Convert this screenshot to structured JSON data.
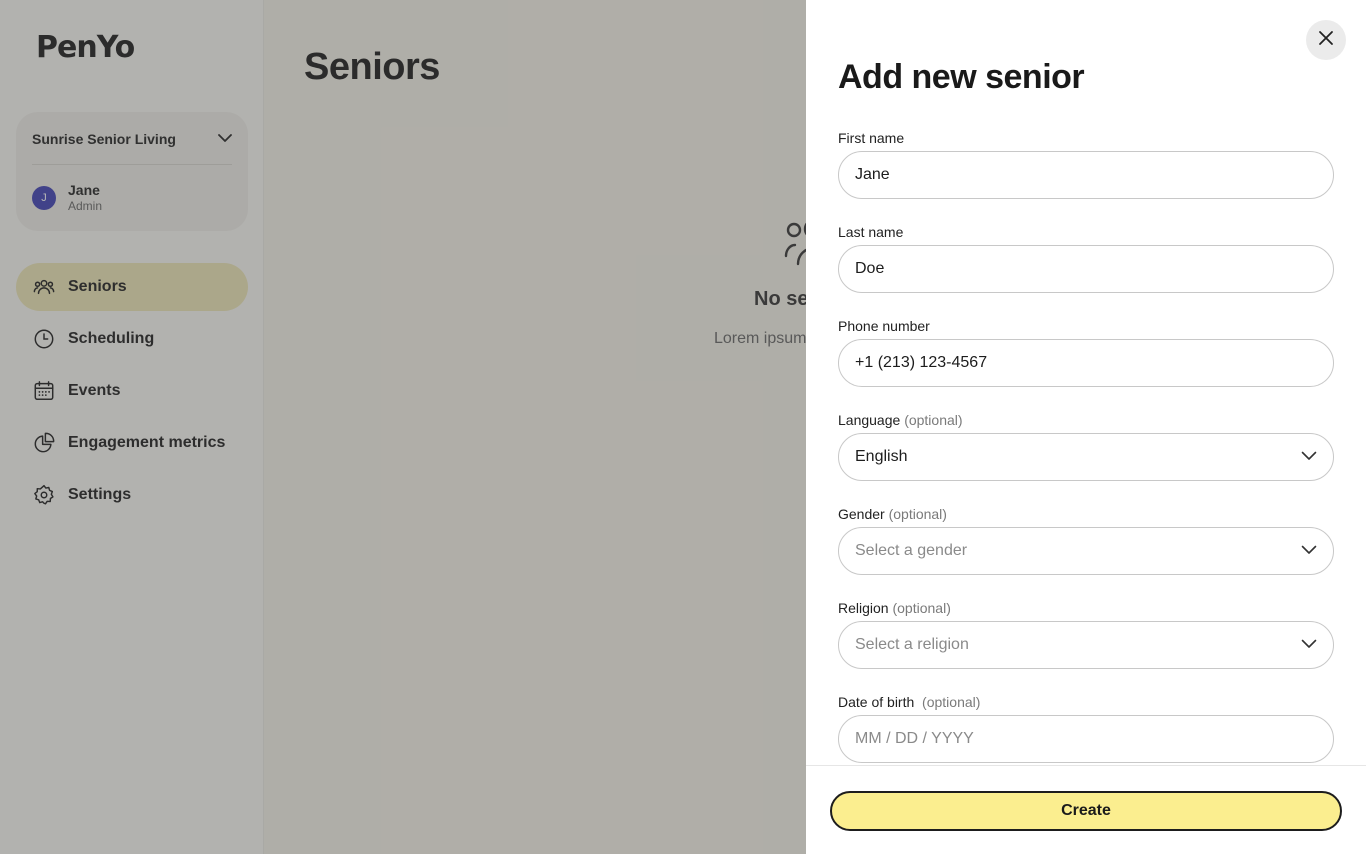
{
  "app": {
    "logo": "PenYo"
  },
  "sidebar": {
    "org_name": "Sunrise Senior Living",
    "user": {
      "initial": "J",
      "name": "Jane",
      "role": "Admin"
    },
    "items": [
      {
        "label": "Seniors",
        "icon": "users-icon",
        "active": true
      },
      {
        "label": "Scheduling",
        "icon": "clock-icon"
      },
      {
        "label": "Events",
        "icon": "calendar-icon"
      },
      {
        "label": "Engagement metrics",
        "icon": "pie-chart-icon"
      },
      {
        "label": "Settings",
        "icon": "gear-icon"
      }
    ]
  },
  "main": {
    "title": "Seniors",
    "empty_title": "No se",
    "empty_desc": "Lorem ipsum"
  },
  "drawer": {
    "title": "Add new senior",
    "first_name": {
      "label": "First name",
      "value": "Jane"
    },
    "last_name": {
      "label": "Last name",
      "value": "Doe"
    },
    "phone": {
      "label": "Phone number",
      "value": "+1 (213) 123-4567"
    },
    "language": {
      "label": "Language",
      "optional": "(optional)",
      "value": "English"
    },
    "gender": {
      "label": "Gender",
      "optional": "(optional)",
      "placeholder": "Select a gender"
    },
    "religion": {
      "label": "Religion",
      "optional": "(optional)",
      "placeholder": "Select a religion"
    },
    "dob": {
      "label": "Date of birth",
      "optional": "(optional)",
      "placeholder": "MM / DD / YYYY"
    },
    "create_label": "Create"
  },
  "colors": {
    "accent": "#fbee8f",
    "nav_active": "#efe8b7",
    "avatar": "#3e40b6",
    "overlay": "rgba(70,70,70,0.40)"
  }
}
